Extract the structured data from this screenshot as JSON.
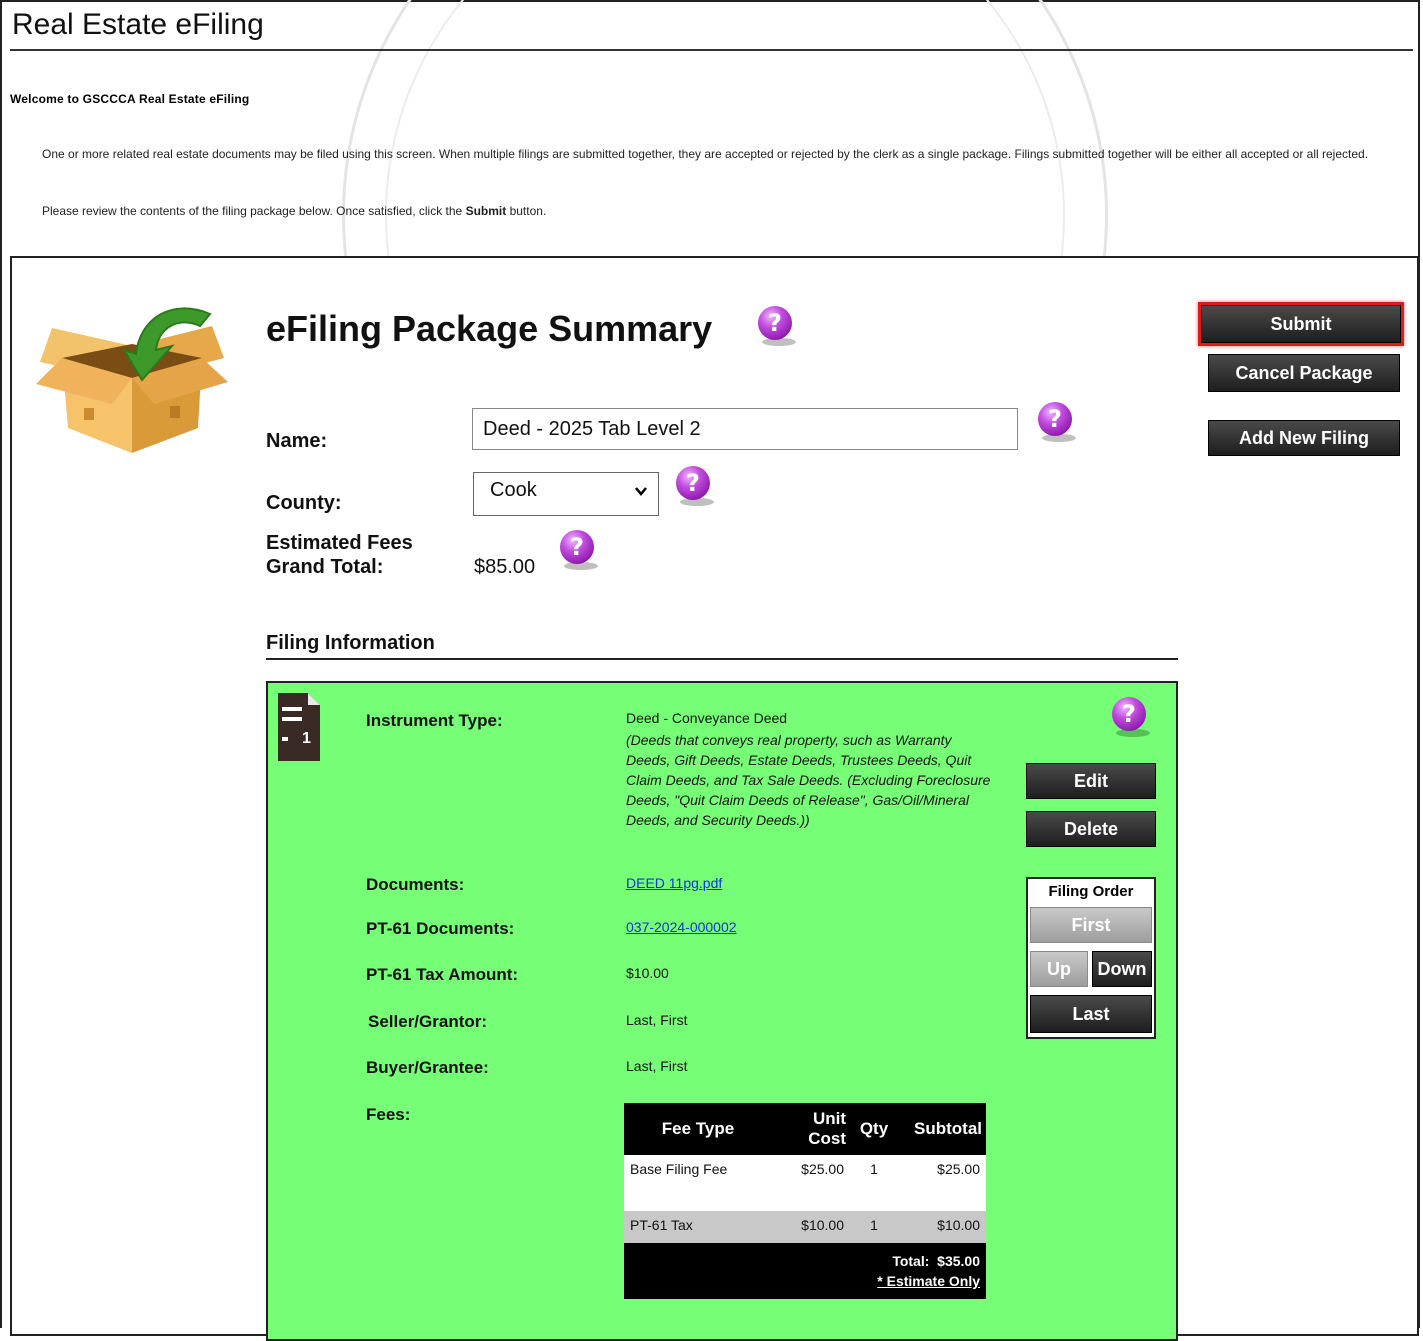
{
  "page": {
    "title": "Real Estate eFiling",
    "welcome": "Welcome to GSCCCA Real Estate eFiling",
    "intro": "One or more related real estate documents may be filed using this screen. When multiple filings are submitted together, they are accepted or rejected by the clerk as a single package. Filings submitted together will be either all accepted or all rejected.",
    "review_before": "Please review the contents of the filing package below. Once satisfied, click the ",
    "review_bold": "Submit",
    "review_after": " button."
  },
  "summary": {
    "title": "eFiling Package Summary",
    "name_label": "Name:",
    "name_value": "Deed - 2025 Tab Level 2",
    "county_label": "County:",
    "county_value": "Cook",
    "fees_label_1": "Estimated Fees",
    "fees_label_2": "Grand Total:",
    "fees_value": "$85.00"
  },
  "actions": {
    "submit": "Submit",
    "cancel": "Cancel Package",
    "add": "Add New Filing"
  },
  "filing_section": {
    "title": "Filing Information"
  },
  "filing": {
    "number": "1",
    "instrument_label": "Instrument Type:",
    "instrument_value": "Deed - Conveyance Deed",
    "instrument_desc": "(Deeds that conveys real property, such as Warranty Deeds, Gift Deeds, Estate Deeds, Trustees Deeds, Quit Claim Deeds, and Tax Sale Deeds. (Excluding Foreclosure Deeds, \"Quit Claim Deeds of Release\", Gas/Oil/Mineral Deeds, and Security Deeds.))",
    "documents_label": "Documents:",
    "documents_value": "DEED 11pg.pdf",
    "pt61_docs_label": "PT-61 Documents:",
    "pt61_docs_value": "037-2024-000002",
    "pt61_tax_label": "PT-61 Tax Amount:",
    "pt61_tax_value": "$10.00",
    "seller_label": "Seller/Grantor:",
    "seller_value": "Last, First",
    "buyer_label": "Buyer/Grantee:",
    "buyer_value": "Last, First",
    "fees_label": "Fees:",
    "edit": "Edit",
    "delete": "Delete",
    "order_title": "Filing Order",
    "order_first": "First",
    "order_up": "Up",
    "order_down": "Down",
    "order_last": "Last",
    "fee_table": {
      "headers": [
        "Fee Type",
        "Unit Cost",
        "Qty",
        "Subtotal"
      ],
      "rows": [
        {
          "type": "Base Filing Fee",
          "unit": "$25.00",
          "qty": "1",
          "subtotal": "$25.00"
        },
        {
          "type": "PT-61 Tax",
          "unit": "$10.00",
          "qty": "1",
          "subtotal": "$10.00"
        }
      ],
      "total_label": "Total:",
      "total_value": "$35.00",
      "estimate": "* Estimate Only"
    }
  },
  "colors": {
    "filing_card_bg": "#76ff76",
    "submit_highlight": "#e01a1a",
    "help_icon": "#a020c0",
    "link": "#0a35d8"
  },
  "icons": [
    "help-question-icon",
    "package-box-icon",
    "document-icon",
    "chevron-down-icon"
  ]
}
